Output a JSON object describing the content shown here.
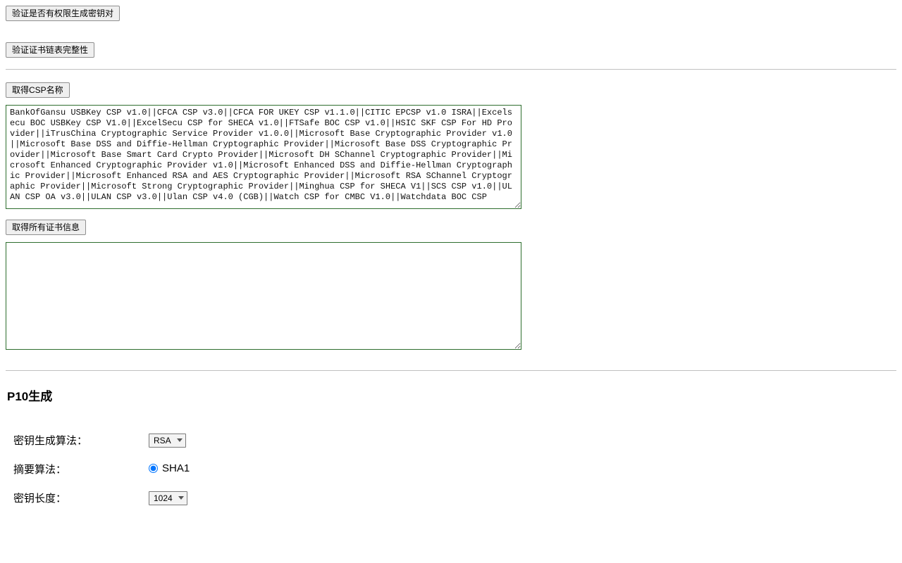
{
  "buttons": {
    "verify_keygen_permission": "验证是否有权限生成密钥对",
    "verify_cert_chain": "验证证书链表完整性",
    "get_csp_name": "取得CSP名称",
    "get_all_certs": "取得所有证书信息"
  },
  "csp": {
    "names": "BankOfGansu USBKey CSP v1.0||CFCA CSP v3.0||CFCA FOR UKEY CSP v1.1.0||CITIC EPCSP v1.0 ISRA||Excelsecu BOC USBKey CSP V1.0||ExcelSecu CSP for SHECA v1.0||FTSafe BOC CSP v1.0||HSIC SKF CSP For HD Provider||iTrusChina Cryptographic Service Provider v1.0.0||Microsoft Base Cryptographic Provider v1.0||Microsoft Base DSS and Diffie-Hellman Cryptographic Provider||Microsoft Base DSS Cryptographic Provider||Microsoft Base Smart Card Crypto Provider||Microsoft DH SChannel Cryptographic Provider||Microsoft Enhanced Cryptographic Provider v1.0||Microsoft Enhanced DSS and Diffie-Hellman Cryptographic Provider||Microsoft Enhanced RSA and AES Cryptographic Provider||Microsoft RSA SChannel Cryptographic Provider||Microsoft Strong Cryptographic Provider||Minghua CSP for SHECA V1||SCS CSP v1.0||ULAN CSP OA v3.0||ULAN CSP v3.0||Ulan CSP v4.0 (CGB)||Watch CSP for CMBC V1.0||Watchdata BOC CSP"
  },
  "certs": {
    "value": ""
  },
  "p10": {
    "heading": "P10生成",
    "fields": {
      "key_alg": {
        "label": "密钥生成算法：",
        "value": "RSA"
      },
      "digest_alg": {
        "label": "摘要算法：",
        "options": [
          "SHA1"
        ],
        "selected": "SHA1"
      },
      "key_len": {
        "label": "密钥长度：",
        "value": "1024"
      }
    }
  }
}
